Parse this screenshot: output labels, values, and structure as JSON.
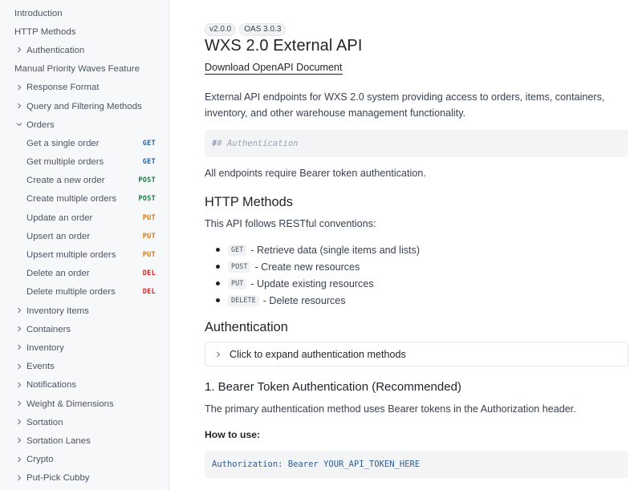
{
  "sidebar": {
    "items": [
      {
        "label": "Introduction"
      },
      {
        "label": "HTTP Methods"
      },
      {
        "label": "Authentication"
      },
      {
        "label": "Manual Priority Waves Feature"
      },
      {
        "label": "Response Format"
      },
      {
        "label": "Query and Filtering Methods"
      },
      {
        "label": "Orders"
      },
      {
        "label": "Get a single order",
        "method": "GET"
      },
      {
        "label": "Get multiple orders",
        "method": "GET"
      },
      {
        "label": "Create a new order",
        "method": "POST"
      },
      {
        "label": "Create multiple orders",
        "method": "POST"
      },
      {
        "label": "Update an order",
        "method": "PUT"
      },
      {
        "label": "Upsert an order",
        "method": "PUT"
      },
      {
        "label": "Upsert multiple orders",
        "method": "PUT"
      },
      {
        "label": "Delete an order",
        "method": "DEL"
      },
      {
        "label": "Delete multiple orders",
        "method": "DEL"
      },
      {
        "label": "Inventory Items"
      },
      {
        "label": "Containers"
      },
      {
        "label": "Inventory"
      },
      {
        "label": "Events"
      },
      {
        "label": "Notifications"
      },
      {
        "label": "Weight & Dimensions"
      },
      {
        "label": "Sortation"
      },
      {
        "label": "Sortation Lanes"
      },
      {
        "label": "Crypto"
      },
      {
        "label": "Put-Pick Cubby"
      }
    ]
  },
  "main": {
    "version_badge": "v2.0.0",
    "oas_badge": "OAS 3.0.3",
    "title": "WXS 2.0 External API",
    "download_link": "Download OpenAPI Document",
    "intro_line1": "External API endpoints for WXS 2.0 system providing access to orders, items, containers,",
    "intro_line2": "inventory, and other warehouse management functionality.",
    "code_comment_hash": "#",
    "code_comment_rest": "# Authentication",
    "auth_note": "All endpoints require Bearer token authentication.",
    "http_methods_heading": "HTTP Methods",
    "http_methods_intro": "This API follows RESTful conventions:",
    "methods": [
      {
        "code": "GET",
        "desc": "- Retrieve data (single items and lists)"
      },
      {
        "code": "POST",
        "desc": "- Create new resources"
      },
      {
        "code": "PUT",
        "desc": "- Update existing resources"
      },
      {
        "code": "DELETE",
        "desc": "- Delete resources"
      }
    ],
    "auth_heading": "Authentication",
    "expander_label": "Click to expand authentication methods",
    "bearer_heading": "1. Bearer Token Authentication (Recommended)",
    "bearer_desc": "The primary authentication method uses Bearer tokens in the Authorization header.",
    "how_to_use": "How to use:",
    "code_example": "Authorization: Bearer YOUR_API_TOKEN_HERE"
  },
  "colors": {
    "get": "#2563a8",
    "post": "#15803d",
    "put": "#d97706",
    "delete": "#dc2626"
  }
}
